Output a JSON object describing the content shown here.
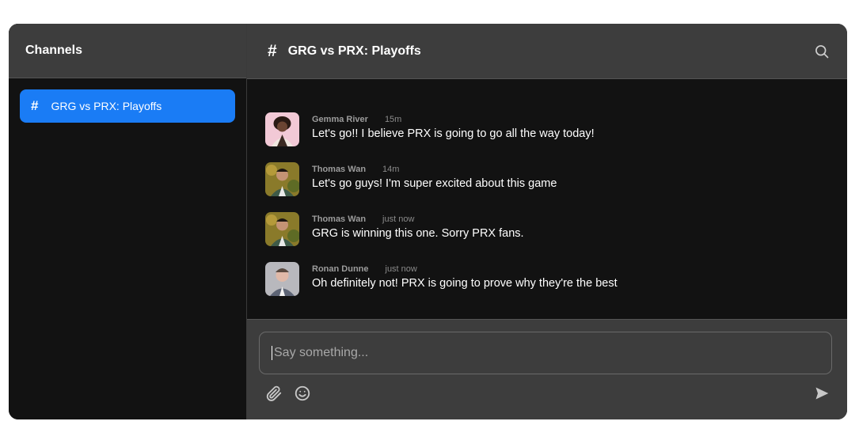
{
  "sidebar": {
    "title": "Channels",
    "channels": [
      {
        "hash": "#",
        "name": "GRG vs PRX: Playoffs",
        "active": true
      }
    ]
  },
  "header": {
    "hash": "#",
    "title": "GRG vs PRX: Playoffs",
    "search_icon": "search-icon"
  },
  "messages": [
    {
      "author": "Gemma River",
      "time": "15m",
      "text": "Let's go!! I believe PRX is going to go all the way today!",
      "avatar": "avatar-gemma"
    },
    {
      "author": "Thomas Wan",
      "time": "14m",
      "text": "Let's go guys! I'm super excited about this game",
      "avatar": "avatar-thomas"
    },
    {
      "author": "Thomas Wan",
      "time": "just now",
      "text": "GRG is winning this one. Sorry PRX fans.",
      "avatar": "avatar-thomas"
    },
    {
      "author": "Ronan Dunne",
      "time": "just now",
      "text": "Oh definitely not! PRX is going to prove why they're the best",
      "avatar": "avatar-ronan"
    }
  ],
  "composer": {
    "placeholder": "Say something...",
    "value": "",
    "attach_icon": "paperclip-icon",
    "emoji_icon": "smiley-icon",
    "send_icon": "send-icon"
  },
  "colors": {
    "accent": "#1a7cf5",
    "panel": "#3d3d3d",
    "background": "#121212"
  }
}
